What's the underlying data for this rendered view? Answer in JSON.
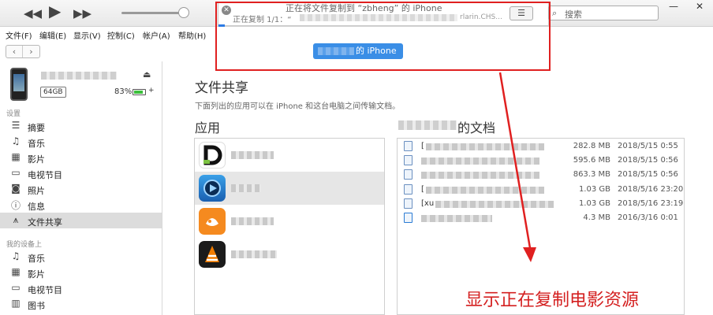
{
  "status": {
    "title": "正在将文件复制到 “zbheng” 的 iPhone",
    "detail": "正在复制 1/1：“",
    "tail": "rlarin.CHS..."
  },
  "search": {
    "placeholder": "搜索",
    "icon": "search-icon"
  },
  "menu": {
    "items": [
      "文件(F)",
      "编辑(E)",
      "显示(V)",
      "控制(C)",
      "帐户(A)",
      "帮助(H)"
    ]
  },
  "device": {
    "capacity": "64GB",
    "battery_pct": "83%",
    "battery_level": 0.83,
    "battery_color": "#3bbf3b"
  },
  "sidebar": {
    "settings_head": "设置",
    "settings_items": [
      {
        "label": "摘要",
        "icon": "summary-icon"
      },
      {
        "label": "音乐",
        "icon": "music-icon"
      },
      {
        "label": "影片",
        "icon": "film-icon"
      },
      {
        "label": "电视节目",
        "icon": "tv-icon"
      },
      {
        "label": "照片",
        "icon": "camera-icon"
      },
      {
        "label": "信息",
        "icon": "info-icon"
      },
      {
        "label": "文件共享",
        "icon": "file-sharing-icon"
      }
    ],
    "my_device_head": "我的设备上",
    "device_items": [
      {
        "label": "音乐",
        "icon": "music-icon"
      },
      {
        "label": "影片",
        "icon": "film-icon"
      },
      {
        "label": "电视节目",
        "icon": "tv-icon"
      },
      {
        "label": "图书",
        "icon": "books-icon"
      }
    ]
  },
  "main": {
    "title": "文件共享",
    "description": "下面列出的应用可以在 iPhone 和这台电脑之间传输文档。",
    "apps_head": "应用",
    "docs_head": "的文档"
  },
  "docs": [
    {
      "name": "[",
      "size": "282.8 MB",
      "date": "2018/5/15 0:55"
    },
    {
      "name": "",
      "size": "595.6 MB",
      "date": "2018/5/15 0:56"
    },
    {
      "name": "",
      "size": "863.3 MB",
      "date": "2018/5/15 0:56"
    },
    {
      "name": "[",
      "size": "1.03 GB",
      "date": "2018/5/16 23:20"
    },
    {
      "name": "[xu",
      "size": "1.03 GB",
      "date": "2018/5/16 23:19"
    },
    {
      "name": "",
      "size": "4.3 MB",
      "date": "2016/3/16 0:01"
    }
  ],
  "overlay": {
    "pill_text": "的 iPhone",
    "annotation": "显示正在复制电影资源",
    "annotation_color": "#d42020"
  }
}
